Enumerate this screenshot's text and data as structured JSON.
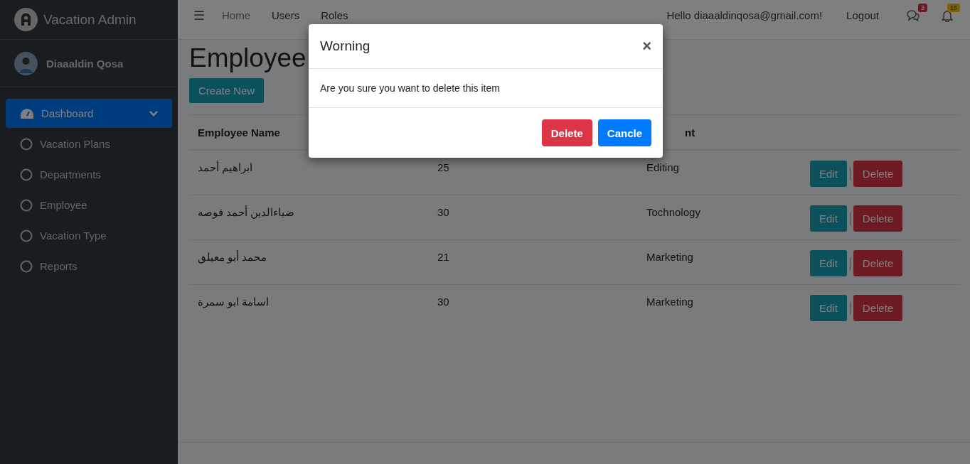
{
  "brand": {
    "title": "Vacation Admin"
  },
  "user": {
    "name": "Diaaaldin Qosa"
  },
  "sidebar": {
    "items": [
      {
        "label": "Dashboard",
        "kind": "parent",
        "selected": true
      },
      {
        "label": "Vacation Plans",
        "kind": "child",
        "selected": false
      },
      {
        "label": "Departments",
        "kind": "child",
        "selected": false
      },
      {
        "label": "Employee",
        "kind": "child",
        "selected": false
      },
      {
        "label": "Vacation Type",
        "kind": "child",
        "selected": false
      },
      {
        "label": "Reports",
        "kind": "child",
        "selected": false
      }
    ]
  },
  "topbar": {
    "menu_icon": "☰",
    "links": [
      "Home",
      "Users",
      "Roles"
    ],
    "greeting": "Hello diaaaldinqosa@gmail.com!",
    "logout": "Logout",
    "messages_count": "3",
    "notifications_count": "15"
  },
  "page": {
    "title": "Employee",
    "create_button": "Create New"
  },
  "table": {
    "columns": [
      {
        "label": "Employee Name"
      },
      {
        "label": "nt",
        "kind": "partial"
      }
    ],
    "rows": [
      {
        "name": "ابراهيم أحمد",
        "column_2": "25",
        "department": "Editing",
        "edit": "Edit",
        "delete": "Delete"
      },
      {
        "name": "ضياءالدين أحمد قوصه",
        "column_2": "30",
        "department": "Tochnology",
        "edit": "Edit",
        "delete": "Delete"
      },
      {
        "name": "محمد أبو معيلق",
        "column_2": "21",
        "department": "Marketing",
        "edit": "Edit",
        "delete": "Delete"
      },
      {
        "name": "اسامة ابو سمرة",
        "column_2": "30",
        "department": "Marketing",
        "edit": "Edit",
        "delete": "Delete"
      }
    ]
  },
  "modal": {
    "title": "Worning",
    "close": "×",
    "message": "Are you sure you want to delete this item",
    "confirm": "Delete",
    "cancel": "Cancle"
  }
}
